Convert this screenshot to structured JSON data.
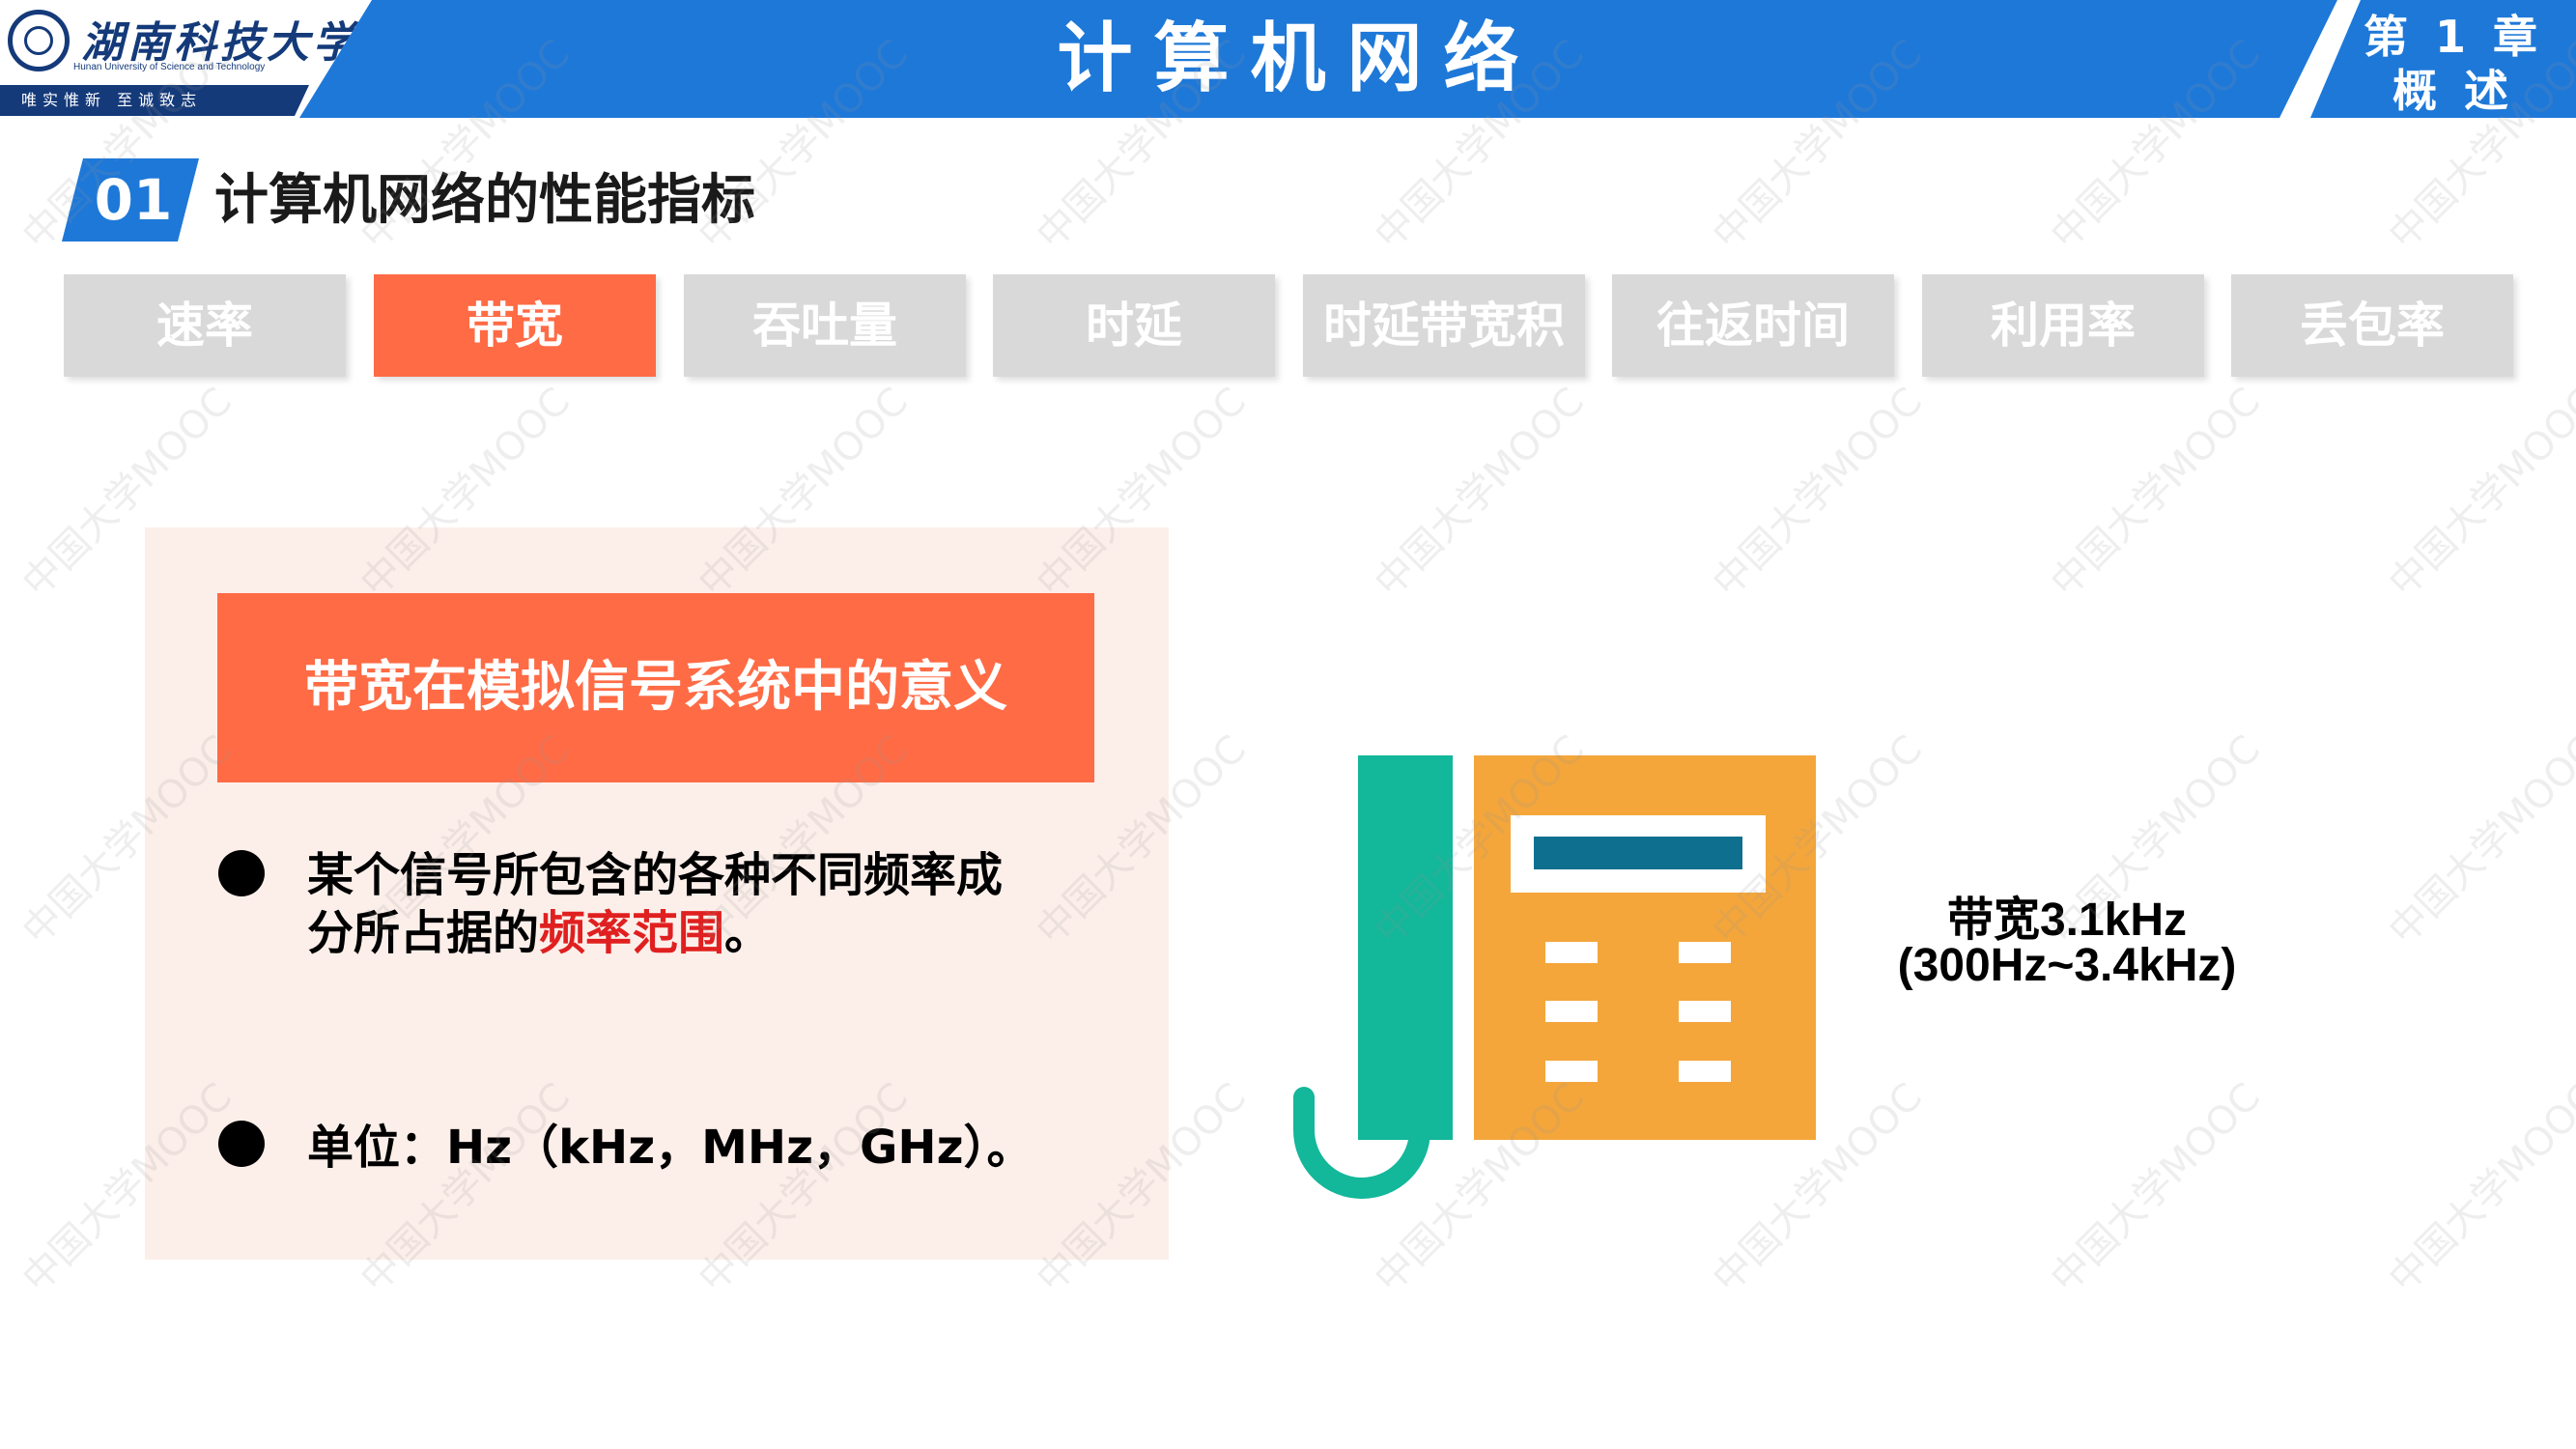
{
  "header": {
    "course_title": "计算机网络",
    "chapter_line1": "第 1 章",
    "chapter_line2": "概 述"
  },
  "logo": {
    "name_cn": "湖南科技大学",
    "name_en": "Hunan University of Science and Technology",
    "motto": "唯实惟新  至诚致志"
  },
  "section": {
    "number": "01",
    "title": "计算机网络的性能指标"
  },
  "tabs": [
    {
      "label": "速率",
      "active": false
    },
    {
      "label": "带宽",
      "active": true
    },
    {
      "label": "吞吐量",
      "active": false
    },
    {
      "label": "时延",
      "active": false
    },
    {
      "label": "时延带宽积",
      "active": false
    },
    {
      "label": "往返时间",
      "active": false
    },
    {
      "label": "利用率",
      "active": false
    },
    {
      "label": "丢包率",
      "active": false
    }
  ],
  "panel": {
    "heading": "带宽在模拟信号系统中的意义",
    "bullet1_line1": "某个信号所包含的各种不同频率成",
    "bullet1_line2_prefix": "分所占据的",
    "bullet1_line2_highlight": "频率范围",
    "bullet1_line2_suffix": "。",
    "bullet2": "单位：Hz（kHz，MHz，GHz）。"
  },
  "illustration": {
    "icon": "telephone-icon",
    "caption_line1": "带宽3.1kHz",
    "caption_line2": "(300Hz~3.4kHz)"
  },
  "watermark": "中国大学MOOC",
  "colors": {
    "brand_blue": "#1e78d8",
    "accent_orange": "#ff6b45",
    "tab_inactive": "#d9d9d9",
    "panel_bg": "#fcefea",
    "highlight_red": "#e02020",
    "phone_green": "#13b79a",
    "phone_orange": "#f4a63b",
    "phone_screen": "#0f6f8e"
  }
}
